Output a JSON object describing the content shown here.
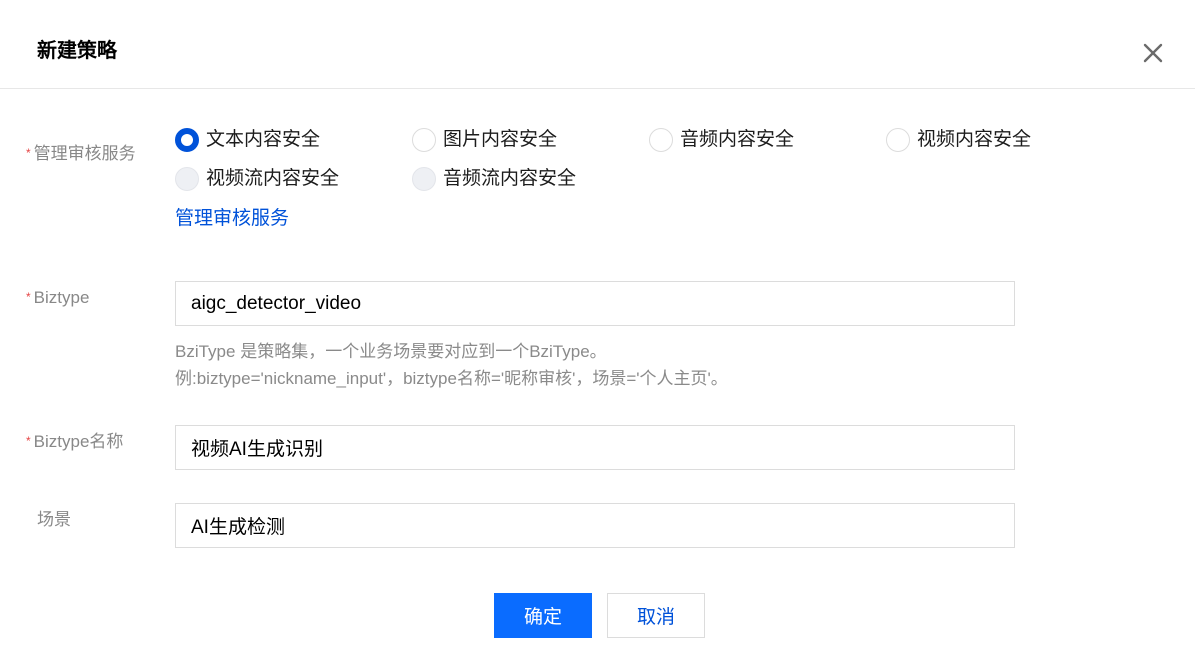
{
  "dialog": {
    "title": "新建策略",
    "close_icon": "close-icon"
  },
  "form": {
    "service": {
      "required_mark": "*",
      "label": "管理审核服务",
      "options": [
        {
          "label": "文本内容安全",
          "state": "checked"
        },
        {
          "label": "图片内容安全",
          "state": "unchecked"
        },
        {
          "label": "音频内容安全",
          "state": "unchecked"
        },
        {
          "label": "视频内容安全",
          "state": "unchecked"
        },
        {
          "label": "视频流内容安全",
          "state": "disabled"
        },
        {
          "label": "音频流内容安全",
          "state": "disabled"
        }
      ],
      "manage_link": "管理审核服务"
    },
    "biztype": {
      "required_mark": "*",
      "label": "Biztype",
      "value": "aigc_detector_video",
      "hint_line1": "BziType 是策略集，一个业务场景要对应到一个BziType。",
      "hint_line2": "例:biztype='nickname_input'，biztype名称='昵称审核'，场景='个人主页'。"
    },
    "biztype_name": {
      "required_mark": "*",
      "label": "Biztype名称",
      "value": "视频AI生成识别"
    },
    "scene": {
      "label": "场景",
      "value": "AI生成检测"
    }
  },
  "footer": {
    "confirm_label": "确定",
    "cancel_label": "取消"
  },
  "colors": {
    "primary": "#0052d9",
    "button_primary": "#0a6cff",
    "required": "#e54545"
  }
}
